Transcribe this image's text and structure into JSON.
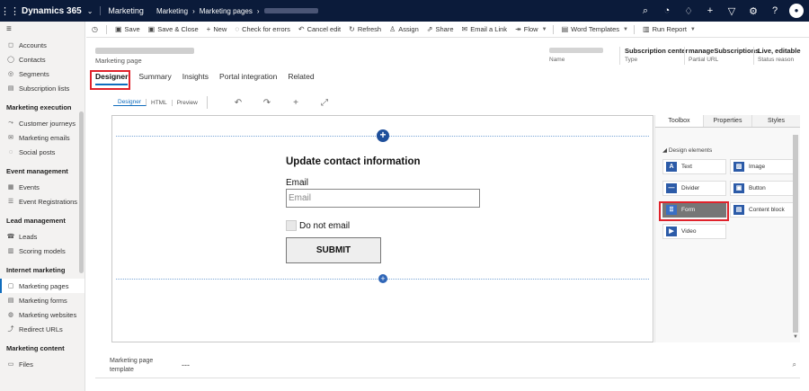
{
  "topbar": {
    "brand": "Dynamics 365",
    "app": "Marketing",
    "breadcrumb": [
      "Marketing",
      "Marketing pages"
    ],
    "icons": [
      "search-icon",
      "task-icon",
      "lightbulb-icon",
      "plus-icon",
      "filter-icon",
      "gear-icon",
      "help-icon",
      "avatar-icon"
    ]
  },
  "sidebar": {
    "items_top": [
      {
        "label": "Accounts",
        "icon": "◻"
      },
      {
        "label": "Contacts",
        "icon": "◯"
      },
      {
        "label": "Segments",
        "icon": "◎"
      },
      {
        "label": "Subscription lists",
        "icon": "▤"
      }
    ],
    "group1": "Marketing execution",
    "items1": [
      {
        "label": "Customer journeys",
        "icon": "⤳"
      },
      {
        "label": "Marketing emails",
        "icon": "✉"
      },
      {
        "label": "Social posts",
        "icon": "◌"
      }
    ],
    "group2": "Event management",
    "items2": [
      {
        "label": "Events",
        "icon": "▦"
      },
      {
        "label": "Event Registrations",
        "icon": "☰"
      }
    ],
    "group3": "Lead management",
    "items3": [
      {
        "label": "Leads",
        "icon": "☎"
      },
      {
        "label": "Scoring models",
        "icon": "▥"
      }
    ],
    "group4": "Internet marketing",
    "items4": [
      {
        "label": "Marketing pages",
        "icon": "▢"
      },
      {
        "label": "Marketing forms",
        "icon": "▤"
      },
      {
        "label": "Marketing websites",
        "icon": "◍"
      },
      {
        "label": "Redirect URLs",
        "icon": "⤴"
      }
    ],
    "group5": "Marketing content",
    "items5": [
      {
        "label": "Files",
        "icon": "▭"
      }
    ]
  },
  "commands": {
    "save": "Save",
    "save_close": "Save & Close",
    "new": "New",
    "check_errors": "Check for errors",
    "cancel_edit": "Cancel edit",
    "refresh": "Refresh",
    "assign": "Assign",
    "share": "Share",
    "email_link": "Email a Link",
    "flow": "Flow",
    "word_templates": "Word Templates",
    "run_report": "Run Report"
  },
  "header": {
    "subtitle": "Marketing page",
    "name_label": "Name",
    "type_value": "Subscription center",
    "type_label": "Type",
    "url_value": "manageSubscriptions",
    "url_label": "Partial URL",
    "status_value": "Live, editable",
    "status_label": "Status reason"
  },
  "tabs": [
    "Designer",
    "Summary",
    "Insights",
    "Portal integration",
    "Related"
  ],
  "designer_views": [
    "Designer",
    "HTML",
    "Preview"
  ],
  "form": {
    "title": "Update contact information",
    "email_label": "Email",
    "email_placeholder": "Email",
    "checkbox_label": "Do not email",
    "submit_label": "SUBMIT"
  },
  "panel": {
    "tabs": [
      "Toolbox",
      "Properties",
      "Styles"
    ],
    "section": "Design elements",
    "elements": [
      {
        "label": "Text",
        "icon": "A"
      },
      {
        "label": "Image",
        "icon": "▨"
      },
      {
        "label": "Divider",
        "icon": "—"
      },
      {
        "label": "Button",
        "icon": "▣"
      },
      {
        "label": "Form",
        "icon": "⍐"
      },
      {
        "label": "Content block",
        "icon": "▤"
      },
      {
        "label": "Video",
        "icon": "▶"
      }
    ]
  },
  "footer": {
    "label": "Marketing page template",
    "value": "---"
  }
}
